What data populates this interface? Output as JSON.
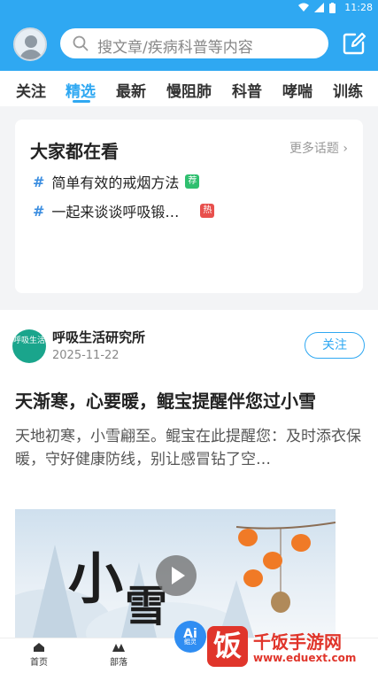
{
  "status_bar": {
    "time": "11:28"
  },
  "header": {
    "search_placeholder": "搜文章/疾病科普等内容"
  },
  "tabs": [
    {
      "label": "关注"
    },
    {
      "label": "精选",
      "active": true
    },
    {
      "label": "最新"
    },
    {
      "label": "慢阻肺"
    },
    {
      "label": "科普"
    },
    {
      "label": "哮喘"
    },
    {
      "label": "训练"
    }
  ],
  "trending": {
    "title": "大家都在看",
    "more": "更多话题",
    "topics": [
      {
        "hash": "#",
        "text": "简单有效的戒烟方法",
        "badge": "荐",
        "badge_color": "#2fbf6f"
      },
      {
        "hash": "#",
        "text": "一起来谈谈呼吸锻…",
        "badge": "热",
        "badge_color": "#e8504d"
      }
    ]
  },
  "post": {
    "author": "呼吸生活研究所",
    "avatar_text": "呼吸生活",
    "date": "2025-11-22",
    "follow_label": "关注",
    "title": "天渐寒，心要暖，鲲宝提醒伴您过小雪",
    "excerpt": "天地初寒，小雪翩至。鲲宝在此提醒您：及时添衣保暖，守好健康防线，别让感冒钻了空…",
    "media": {
      "char1": "小",
      "char2": "雪"
    }
  },
  "bottom_nav": [
    {
      "label": "首页",
      "icon": "home-icon"
    },
    {
      "label": "部落",
      "icon": "tribe-icon"
    }
  ],
  "ai_button": {
    "label": "Ai",
    "sublabel": "鲲灵"
  },
  "watermark": {
    "logo": "饭",
    "title": "千饭手游网",
    "url": "www.eduext.com"
  },
  "colors": {
    "primary": "#2fa8f2",
    "hot": "#e8504d",
    "recommend": "#2fbf6f",
    "watermark": "#e0352b"
  }
}
